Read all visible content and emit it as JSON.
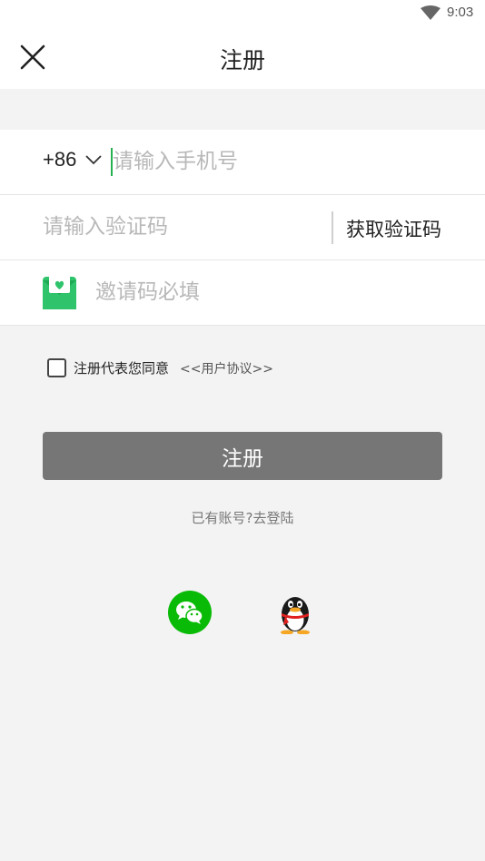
{
  "status_bar": {
    "time": "9:03"
  },
  "header": {
    "title": "注册"
  },
  "form": {
    "country_code": "+86",
    "phone_placeholder": "请输入手机号",
    "code_placeholder": "请输入验证码",
    "get_code_label": "获取验证码",
    "invite_placeholder": "邀请码必填"
  },
  "agreement": {
    "text": "注册代表您同意",
    "link": "<<用户协议>>"
  },
  "register_button": "注册",
  "login_link": "已有账号?去登陆",
  "colors": {
    "accent_green": "#27b04f",
    "button_gray": "#767676",
    "wechat_green": "#09bb07"
  }
}
